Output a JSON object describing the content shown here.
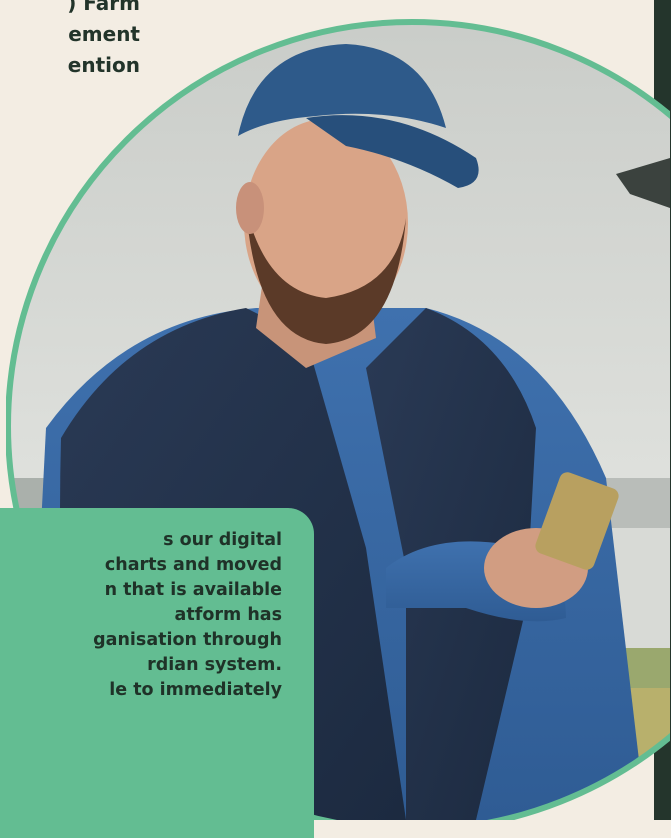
{
  "heading": {
    "lines": [
      ") Farm",
      "ement",
      "ention"
    ]
  },
  "quote": {
    "lines": [
      "s our digital",
      "charts and moved",
      "n that is available",
      "atform has",
      "ganisation through",
      "rdian system.",
      "le to immediately"
    ]
  },
  "colors": {
    "background": "#f3ede3",
    "accent_green": "#63bd92",
    "dark_text": "#22342a",
    "side_panel": "#24352c"
  },
  "icons": {
    "photo": "farmer-using-phone-photo"
  }
}
